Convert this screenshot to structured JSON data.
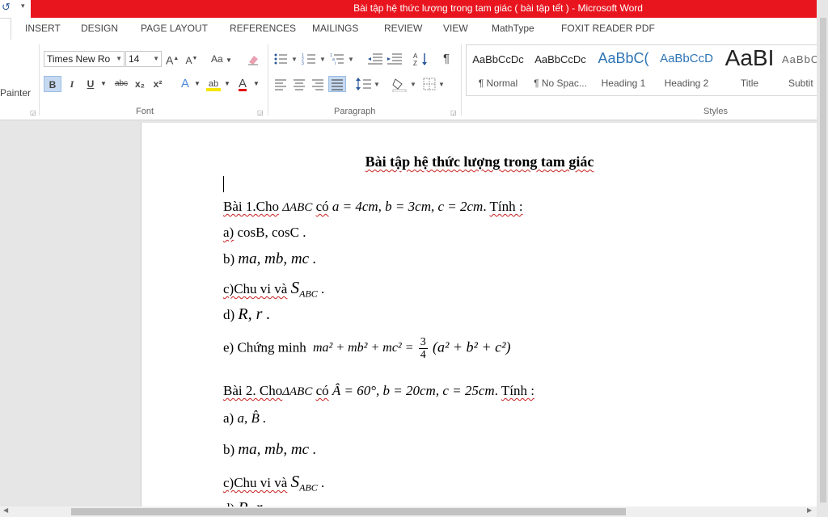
{
  "window": {
    "title": "Bài tập hệ thức lượng trong tam giác ( bài tập tết ) -  Microsoft Word"
  },
  "tabs": [
    "INSERT",
    "DESIGN",
    "PAGE LAYOUT",
    "REFERENCES",
    "MAILINGS",
    "REVIEW",
    "VIEW",
    "MathType",
    "FOXIT READER PDF"
  ],
  "ribbon": {
    "clipboard": {
      "painter_label": "Painter"
    },
    "font": {
      "group_label": "Font",
      "font_name": "Times New Ro",
      "font_size": "14",
      "change_case": "Aa",
      "bold": "B",
      "italic": "I",
      "underline": "U",
      "strikethrough": "abc",
      "subscript": "x₂",
      "superscript": "x²",
      "grow": "A",
      "shrink": "A",
      "text_effects": "A",
      "highlight": "ab",
      "font_color": "A",
      "highlight_color": "#f5e600",
      "font_color_value": "#e00000"
    },
    "paragraph": {
      "group_label": "Paragraph",
      "pilcrow": "¶"
    },
    "styles": {
      "group_label": "Styles",
      "items": [
        {
          "sample": "AaBbCcDc",
          "name": "¶ Normal"
        },
        {
          "sample": "AaBbCcDc",
          "name": "¶ No Spac..."
        },
        {
          "sample": "AaBbC(",
          "name": "Heading 1"
        },
        {
          "sample": "AaBbCcD",
          "name": "Heading 2"
        },
        {
          "sample": "AaBI",
          "name": "Title"
        },
        {
          "sample": "AaBbC",
          "name": "Subtit"
        }
      ]
    }
  },
  "document": {
    "title": "Bài tập hệ thức lượng trong tam giác",
    "lines": {
      "b1_intro": "Bài 1.Cho",
      "b1_tri": "ΔABC",
      "b1_co": "có",
      "b1_given": "a = 4cm, b = 3cm, c = 2cm",
      "b1_tinh": "Tính :",
      "b1_a_label": "a)",
      "b1_a_text": "cosB, cosC .",
      "b1_b_label": "b)",
      "b1_b_text": "ma, mb, mc .",
      "b1_c_label": "c)Chu vi và",
      "b1_c_math": "S",
      "b1_c_sub": "ABC",
      "b1_d_label": "d)",
      "b1_d_text": "R, r .",
      "b1_e_label": "e) Chứng minh",
      "b1_e_lhs": "ma² + mb² + mc² =",
      "b1_e_num": "3",
      "b1_e_den": "4",
      "b1_e_rhs": "(a² + b² + c²)",
      "b2_intro": "Bài 2. Cho",
      "b2_tri": "ΔABC",
      "b2_co": "có",
      "b2_given": "Â = 60°, b = 20cm, c = 25cm",
      "b2_tinh": "Tính :",
      "b2_a_label": "a)",
      "b2_a_text": "a, B̂ .",
      "b2_b_label": "b)",
      "b2_b_text": "ma, mb, mc .",
      "b2_c_label": "c)Chu vi và",
      "b2_c_math": "S",
      "b2_c_sub": "ABC",
      "b2_d_label": "d)",
      "b2_d_text": "R, r"
    }
  }
}
